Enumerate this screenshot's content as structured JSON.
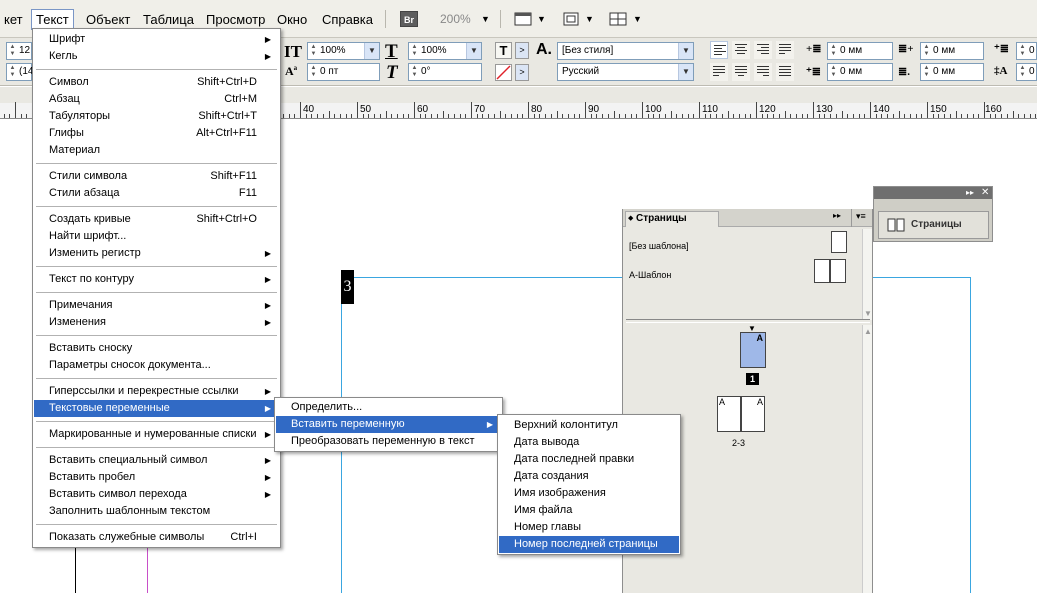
{
  "menubar": {
    "items": [
      "кет",
      "Текст",
      "Объект",
      "Таблица",
      "Просмотр",
      "Окно",
      "Справка"
    ],
    "bridge_label": "Br",
    "zoom": "200%"
  },
  "toolbar": {
    "font_size": "12",
    "leading": "(14",
    "hscale": "100%",
    "vscale": "100%",
    "baseline": "0 пт",
    "skew": "0°",
    "style": "[Без стиля]",
    "language": "Русский",
    "indent_left": "0 мм",
    "indent_right": "0 мм",
    "indent_first": "0 мм",
    "indent_last": "0 мм",
    "space_before_label": "0",
    "space_after_label": "0"
  },
  "ruler": {
    "labels": [
      "40",
      "50",
      "60",
      "70",
      "80",
      "90",
      "100",
      "110",
      "120",
      "130",
      "140",
      "150",
      "160"
    ]
  },
  "document": {
    "page_number": "3"
  },
  "text_menu": {
    "groups": [
      [
        {
          "label": "Шрифт",
          "sub": true
        },
        {
          "label": "Кегль",
          "sub": true
        }
      ],
      [
        {
          "label": "Символ",
          "shortcut": "Shift+Ctrl+D"
        },
        {
          "label": "Абзац",
          "shortcut": "Ctrl+M"
        },
        {
          "label": "Табуляторы",
          "shortcut": "Shift+Ctrl+T"
        },
        {
          "label": "Глифы",
          "shortcut": "Alt+Ctrl+F11"
        },
        {
          "label": "Материал"
        }
      ],
      [
        {
          "label": "Стили символа",
          "shortcut": "Shift+F11"
        },
        {
          "label": "Стили абзаца",
          "shortcut": "F11"
        }
      ],
      [
        {
          "label": "Создать кривые",
          "shortcut": "Shift+Ctrl+O"
        },
        {
          "label": "Найти шрифт..."
        },
        {
          "label": "Изменить регистр",
          "sub": true
        }
      ],
      [
        {
          "label": "Текст по контуру",
          "sub": true
        }
      ],
      [
        {
          "label": "Примечания",
          "sub": true
        },
        {
          "label": "Изменения",
          "sub": true
        }
      ],
      [
        {
          "label": "Вставить сноску"
        },
        {
          "label": "Параметры сносок документа..."
        }
      ],
      [
        {
          "label": "Гиперссылки и перекрестные ссылки",
          "sub": true
        },
        {
          "label": "Текстовые переменные",
          "sub": true,
          "hl": true
        }
      ],
      [
        {
          "label": "Маркированные и нумерованные списки",
          "sub": true
        }
      ],
      [
        {
          "label": "Вставить специальный символ",
          "sub": true
        },
        {
          "label": "Вставить пробел",
          "sub": true
        },
        {
          "label": "Вставить символ перехода",
          "sub": true
        },
        {
          "label": "Заполнить шаблонным текстом"
        }
      ],
      [
        {
          "label": "Показать служебные символы",
          "shortcut": "Ctrl+I"
        }
      ]
    ]
  },
  "variables_menu": {
    "items": [
      {
        "label": "Определить..."
      },
      {
        "label": "Вставить переменную",
        "sub": true,
        "hl": true
      },
      {
        "label": "Преобразовать переменную в текст"
      }
    ]
  },
  "insert_variable_menu": {
    "items": [
      "Верхний колонтитул",
      "Дата вывода",
      "Дата последней правки",
      "Дата создания",
      "Имя изображения",
      "Имя файла",
      "Номер главы",
      "Номер последней страницы"
    ],
    "highlighted_index": 7
  },
  "pages_panel": {
    "tab_label": "Страницы",
    "masters": [
      "[Без шаблона]",
      "А-Шаблон"
    ],
    "page1_label": "1",
    "page1_master": "А",
    "spread_label": "2-3",
    "spread_left_master": "А",
    "spread_right_master": "А"
  },
  "collapsed_panel": {
    "label": "Страницы"
  },
  "colors": {
    "highlight": "#316ac5",
    "page_thumb_selected": "#9fb8e8",
    "guide_cyan": "#3aa6e0",
    "guide_magenta": "#c84fc8"
  }
}
